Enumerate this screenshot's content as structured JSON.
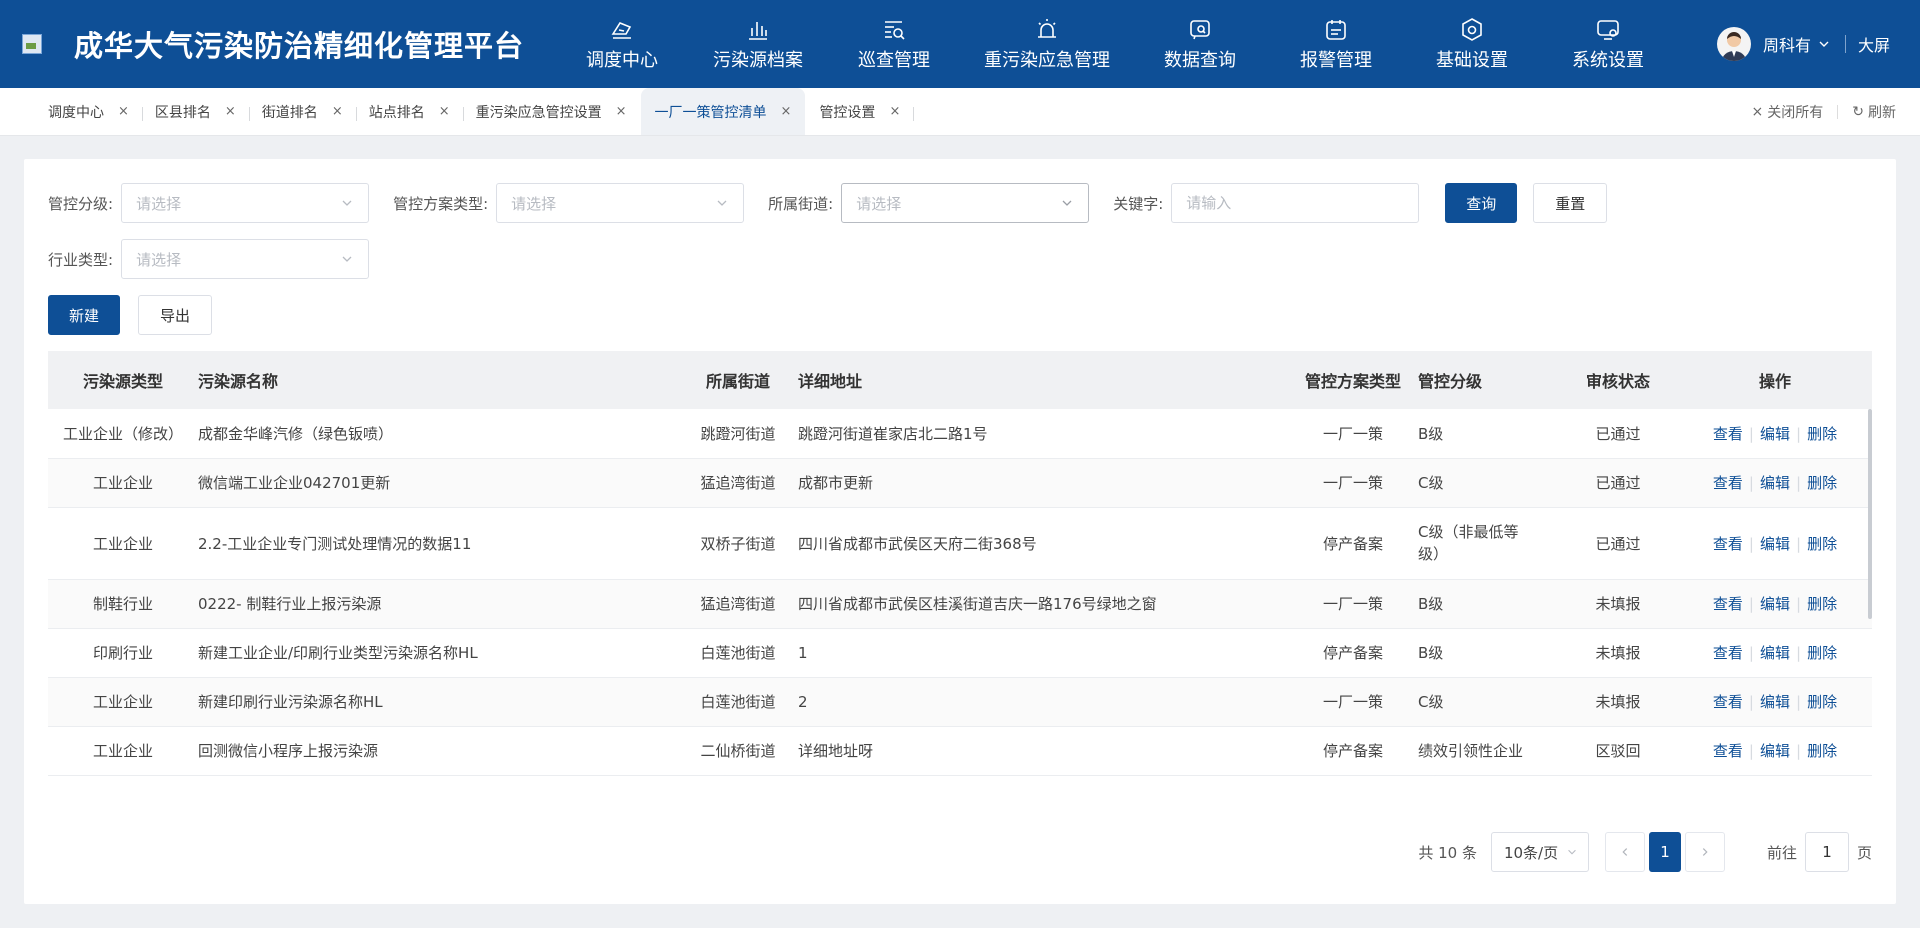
{
  "header": {
    "title": "成华大气污染防治精细化管理平台",
    "nav": [
      {
        "label": "调度中心",
        "icon": "dispatch-icon"
      },
      {
        "label": "污染源档案",
        "icon": "bar-chart-icon"
      },
      {
        "label": "巡查管理",
        "icon": "inspection-icon"
      },
      {
        "label": "重污染应急管理",
        "icon": "alarm-light-icon"
      },
      {
        "label": "数据查询",
        "icon": "data-search-icon"
      },
      {
        "label": "报警管理",
        "icon": "calendar-alert-icon"
      },
      {
        "label": "基础设置",
        "icon": "gear-icon"
      },
      {
        "label": "系统设置",
        "icon": "system-settings-icon"
      }
    ],
    "user_name": "周科有",
    "big_screen": "大屏"
  },
  "tabs": [
    {
      "label": "调度中心"
    },
    {
      "label": "区县排名"
    },
    {
      "label": "街道排名"
    },
    {
      "label": "站点排名"
    },
    {
      "label": "重污染应急管控设置"
    },
    {
      "label": "一厂一策管控清单",
      "active": true
    },
    {
      "label": "管控设置"
    }
  ],
  "tab_actions": {
    "close_all": "关闭所有",
    "refresh": "刷新"
  },
  "filters": {
    "control_level": {
      "label": "管控分级:",
      "placeholder": "请选择"
    },
    "plan_type": {
      "label": "管控方案类型:",
      "placeholder": "请选择"
    },
    "street": {
      "label": "所属街道:",
      "placeholder": "请选择"
    },
    "keyword": {
      "label": "关键字:",
      "placeholder": "请输入"
    },
    "industry": {
      "label": "行业类型:",
      "placeholder": "请选择"
    },
    "query_btn": "查询",
    "reset_btn": "重置"
  },
  "actions": {
    "new_btn": "新建",
    "export_btn": "导出"
  },
  "table": {
    "headers": [
      "污染源类型",
      "污染源名称",
      "所属街道",
      "详细地址",
      "管控方案类型",
      "管控分级",
      "审核状态",
      "操作"
    ],
    "rows": [
      [
        "工业企业（修改）",
        "成都金华峰汽修（绿色钣喷）",
        "跳蹬河街道",
        "跳蹬河街道崔家店北二路1号",
        "一厂一策",
        "B级",
        "已通过"
      ],
      [
        "工业企业",
        "微信端工业企业042701更新",
        "猛追湾街道",
        "成都市更新",
        "一厂一策",
        "C级",
        "已通过"
      ],
      [
        "工业企业",
        "2.2-工业企业专门测试处理情况的数据11",
        "双桥子街道",
        "四川省成都市武侯区天府二街368号",
        "停产备案",
        "C级（非最低等级）",
        "已通过"
      ],
      [
        "制鞋行业",
        "0222- 制鞋行业上报污染源",
        "猛追湾街道",
        "四川省成都市武侯区桂溪街道吉庆一路176号绿地之窗",
        "一厂一策",
        "B级",
        "未填报"
      ],
      [
        "印刷行业",
        "新建工业企业/印刷行业类型污染源名称HL",
        "白莲池街道",
        "1",
        "停产备案",
        "B级",
        "未填报"
      ],
      [
        "工业企业",
        "新建印刷行业污染源名称HL",
        "白莲池街道",
        "2",
        "一厂一策",
        "C级",
        "未填报"
      ],
      [
        "工业企业",
        "回测微信小程序上报污染源",
        "二仙桥街道",
        "详细地址呀",
        "停产备案",
        "绩效引领性企业",
        "区驳回"
      ]
    ],
    "ops": {
      "view": "查看",
      "edit": "编辑",
      "delete": "删除"
    }
  },
  "pagination": {
    "total": "共 10 条",
    "page_size": "10条/页",
    "current": "1",
    "goto_label": "前往",
    "goto_value": "1",
    "page_unit": "页"
  },
  "colors": {
    "brand": "#0e4f96"
  }
}
